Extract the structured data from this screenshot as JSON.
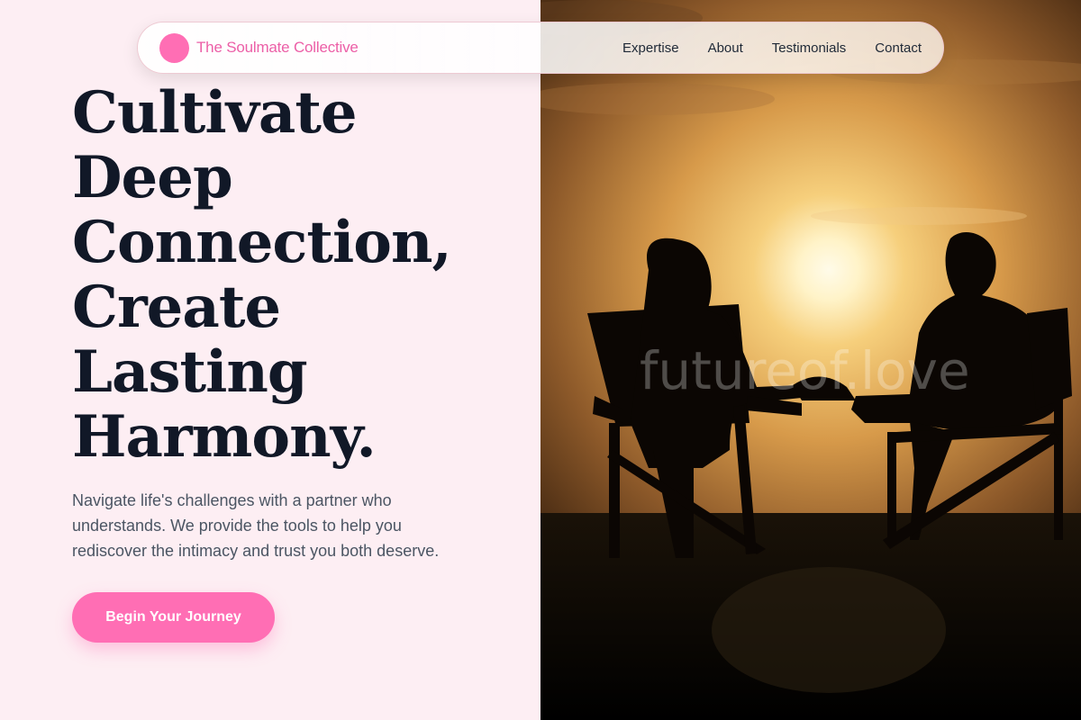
{
  "brand": {
    "name": "The Soulmate Collective",
    "color": "#ff6eb4"
  },
  "nav": {
    "links": [
      {
        "label": "Expertise"
      },
      {
        "label": "About"
      },
      {
        "label": "Testimonials"
      },
      {
        "label": "Contact"
      }
    ]
  },
  "hero": {
    "title_lines": [
      "Cultivate",
      "Deep",
      "Connection,",
      "Create",
      "Lasting",
      "Harmony."
    ],
    "subtitle": "Navigate life's challenges with a partner who understands. We provide the tools to help you rediscover the intimacy and trust you both deserve.",
    "cta_label": "Begin Your Journey"
  },
  "photo": {
    "watermark": "futureof.love",
    "description_icon": "couple-sunset-silhouette-image"
  },
  "colors": {
    "accent": "#ff6eb4",
    "background": "#fdeef3",
    "heading": "#111827",
    "body_text": "#4b5563"
  }
}
